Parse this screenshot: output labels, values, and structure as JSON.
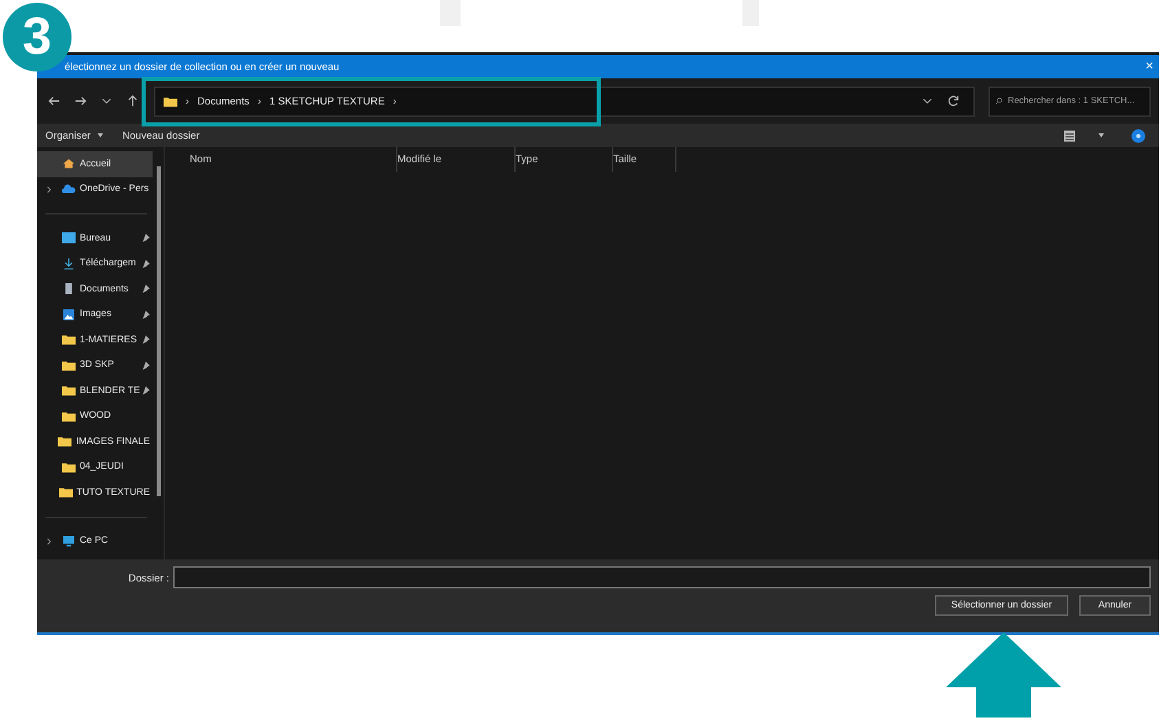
{
  "step_badge": "3",
  "window": {
    "title": "électionnez un dossier de collection ou en créer un nouveau",
    "close": "×"
  },
  "nav": {
    "path": [
      {
        "kind": "separator",
        "label": "›"
      },
      {
        "kind": "crumb",
        "label": "Documents"
      },
      {
        "kind": "separator",
        "label": "›"
      },
      {
        "kind": "crumb",
        "label": "1 SKETCHUP TEXTURE"
      },
      {
        "kind": "separator",
        "label": "›"
      }
    ],
    "search": {
      "placeholder": "Rechercher dans : 1 SKETCH..."
    }
  },
  "toolbar": [
    {
      "label": "Organiser",
      "dropdown": true
    },
    {
      "label": "Nouveau dossier",
      "dropdown": false
    }
  ],
  "columns": [
    "Nom",
    "Modifié le",
    "Type",
    "Taille"
  ],
  "sidebar": [
    {
      "label": "Accueil",
      "kind": "home",
      "pinned": false,
      "selected": true,
      "expandable": false
    },
    {
      "label": "OneDrive - Pers",
      "kind": "cloud",
      "pinned": false,
      "selected": false,
      "expandable": true
    },
    {
      "kind": "divider"
    },
    {
      "label": "Bureau",
      "kind": "desktop",
      "pinned": true,
      "selected": false,
      "expandable": false
    },
    {
      "label": "Téléchargem",
      "kind": "download",
      "pinned": true,
      "selected": false,
      "expandable": false
    },
    {
      "label": "Documents",
      "kind": "document",
      "pinned": true,
      "selected": false,
      "expandable": false
    },
    {
      "label": "Images",
      "kind": "image",
      "pinned": true,
      "selected": false,
      "expandable": false
    },
    {
      "label": "1-MATIERES",
      "kind": "folder",
      "pinned": true,
      "selected": false,
      "expandable": false
    },
    {
      "label": "3D SKP",
      "kind": "folder",
      "pinned": true,
      "selected": false,
      "expandable": false
    },
    {
      "label": "BLENDER TE",
      "kind": "folder",
      "pinned": true,
      "selected": false,
      "expandable": false
    },
    {
      "label": "WOOD",
      "kind": "folder",
      "pinned": false,
      "selected": false,
      "expandable": false
    },
    {
      "label": "IMAGES FINALE",
      "kind": "folder",
      "pinned": false,
      "selected": false,
      "expandable": false
    },
    {
      "label": "04_JEUDI",
      "kind": "folder",
      "pinned": false,
      "selected": false,
      "expandable": false
    },
    {
      "label": "TUTO TEXTURE",
      "kind": "folder",
      "pinned": false,
      "selected": false,
      "expandable": false
    },
    {
      "kind": "divider"
    },
    {
      "label": "Ce PC",
      "kind": "pc",
      "pinned": false,
      "selected": false,
      "expandable": true
    }
  ],
  "folder_field": {
    "label": "Dossier :"
  },
  "buttons": [
    {
      "label": "Sélectionner un dossier"
    },
    {
      "label": "Annuler"
    }
  ]
}
